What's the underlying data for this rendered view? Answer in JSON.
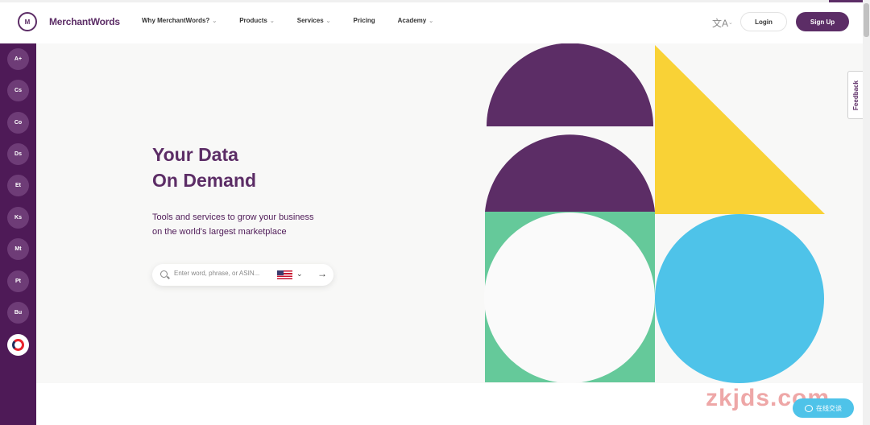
{
  "brand": {
    "name": "MerchantWords",
    "mark": "M"
  },
  "nav": {
    "items": [
      {
        "label": "Why MerchantWords?",
        "has_dropdown": true
      },
      {
        "label": "Products",
        "has_dropdown": true
      },
      {
        "label": "Services",
        "has_dropdown": true
      },
      {
        "label": "Pricing",
        "has_dropdown": false
      },
      {
        "label": "Academy",
        "has_dropdown": true
      }
    ],
    "chevron": "⌄"
  },
  "header": {
    "translate_icon": "文A",
    "login_label": "Login",
    "signup_label": "Sign Up"
  },
  "sidebar": {
    "items": [
      {
        "label": "A+"
      },
      {
        "label": "Cs"
      },
      {
        "label": "Co"
      },
      {
        "label": "Ds"
      },
      {
        "label": "Et"
      },
      {
        "label": "Ks"
      },
      {
        "label": "Mt"
      },
      {
        "label": "Pt"
      },
      {
        "label": "Bu"
      }
    ]
  },
  "hero": {
    "title_line1": "Your Data",
    "title_line2": "On Demand",
    "subtitle_line1": "Tools and services to grow your business",
    "subtitle_line2": "on the world's largest marketplace"
  },
  "search": {
    "placeholder": "Enter word, phrase, or ASIN...",
    "value": "",
    "marketplace_flag": "us-flag-icon",
    "chevron": "⌄",
    "submit_icon": "→"
  },
  "colors": {
    "brand_purple": "#5c2d66",
    "sidebar_purple": "#4e1a57",
    "yellow": "#f9d236",
    "green": "#65c99a",
    "blue": "#4ec3e9"
  },
  "feedback": {
    "label": "Feedback"
  },
  "overlay": {
    "watermark": "zkjds.com",
    "chat_label": "在线交谈"
  }
}
